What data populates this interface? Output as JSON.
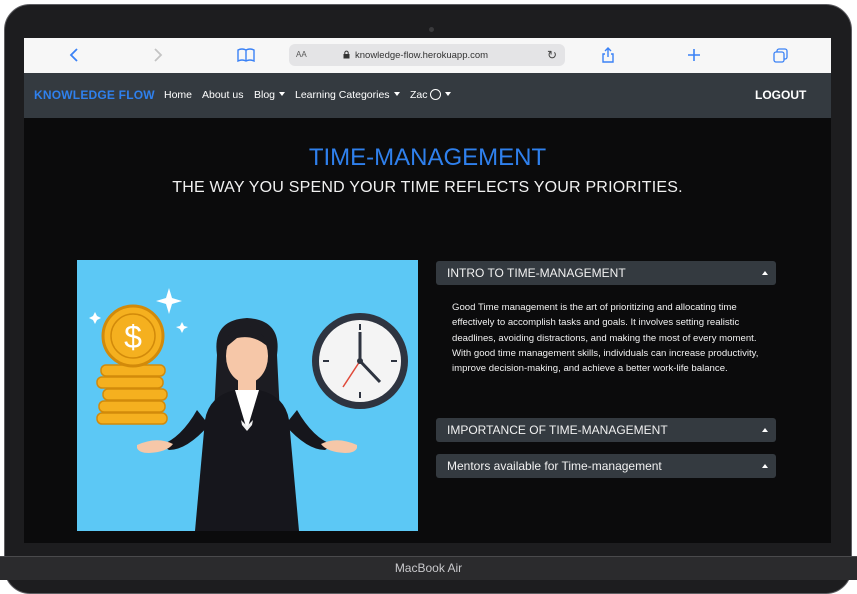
{
  "device": {
    "label": "MacBook Air"
  },
  "browser": {
    "text_size": "AA",
    "url": "knowledge-flow.herokuapp.com"
  },
  "nav": {
    "brand": "KNOWLEDGE FLOW",
    "items": [
      "Home",
      "About us",
      "Blog",
      "Learning Categories",
      "Zac"
    ],
    "logout": "LOGOUT"
  },
  "hero": {
    "title": "TIME-MANAGEMENT",
    "subtitle": "THE WAY YOU SPEND YOUR TIME REFLECTS YOUR PRIORITIES."
  },
  "illustration": {
    "symbol": "$",
    "background": "#5cc8f5"
  },
  "accordion": [
    {
      "header": "INTRO TO TIME-MANAGEMENT",
      "expanded": true,
      "body": "Good Time management is the art of prioritizing and allocating time effectively to accomplish tasks and goals. It involves setting realistic deadlines, avoiding distractions, and making the most of every moment. With good time management skills, individuals can increase productivity, improve decision-making, and achieve a better work-life balance."
    },
    {
      "header": "IMPORTANCE OF TIME-MANAGEMENT",
      "expanded": false
    },
    {
      "header": "Mentors available for Time-management",
      "expanded": false
    }
  ],
  "colors": {
    "accent": "#2f80ed",
    "navbar": "#343a40",
    "background": "#0b0b0c"
  }
}
